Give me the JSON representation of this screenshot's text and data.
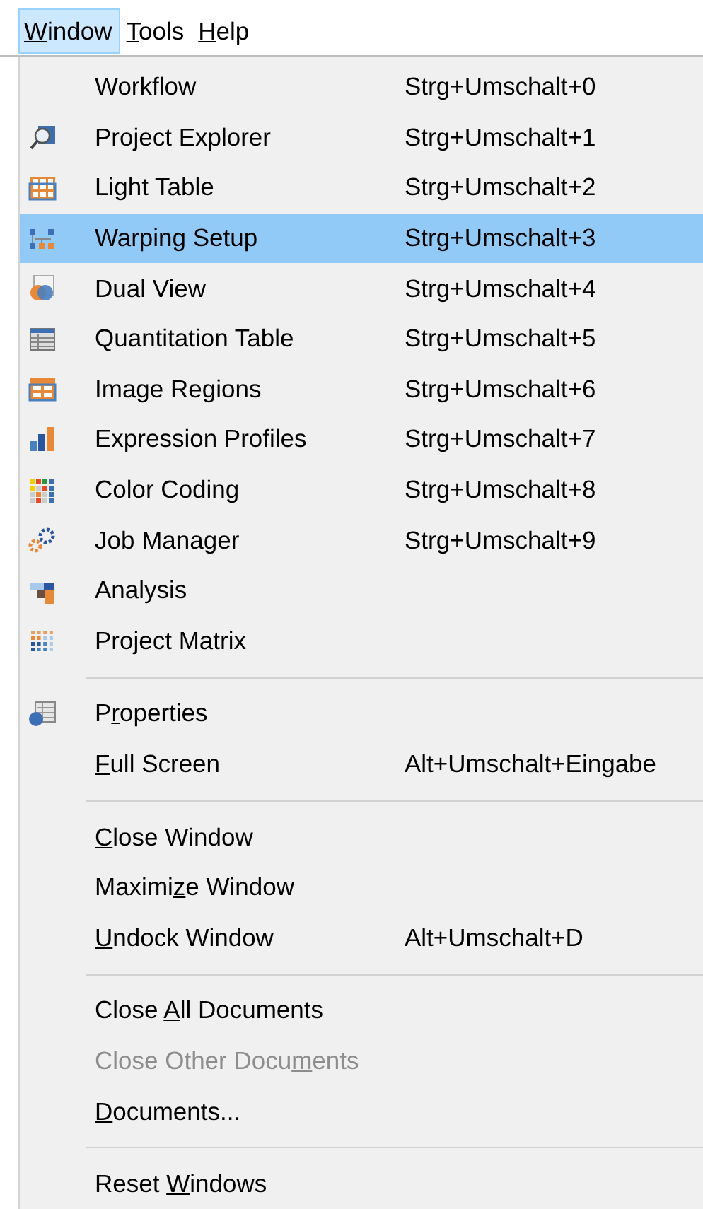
{
  "menubar": [
    {
      "access_key": "W",
      "label_post": "indow",
      "selected": true
    },
    {
      "access_key": "T",
      "label_post": "ools",
      "selected": false
    },
    {
      "access_key": "H",
      "label_post": "elp",
      "selected": false
    }
  ],
  "menu": {
    "groups": [
      [
        {
          "label": "Workflow",
          "shortcut": "Strg+Umschalt+0",
          "selected": false,
          "disabled": false
        },
        {
          "label": "Project Explorer",
          "shortcut": "Strg+Umschalt+1",
          "kind": "magnifier",
          "selected": false,
          "disabled": false
        },
        {
          "label": "Light Table",
          "shortcut": "Strg+Umschalt+2",
          "kind": "tiles",
          "selected": false,
          "disabled": false
        },
        {
          "label": "Warping Setup",
          "shortcut": "Strg+Umschalt+3",
          "kind": "network",
          "selected": true,
          "disabled": false
        },
        {
          "label": "Dual View",
          "shortcut": "Strg+Umschalt+4",
          "kind": "circles",
          "selected": false,
          "disabled": false
        },
        {
          "label": "Quantitation Table",
          "shortcut": "Strg+Umschalt+5",
          "kind": "table",
          "selected": false,
          "disabled": false
        },
        {
          "label": "Image Regions",
          "shortcut": "Strg+Umschalt+6",
          "kind": "regions",
          "selected": false,
          "disabled": false
        },
        {
          "label": "Expression Profiles",
          "shortcut": "Strg+Umschalt+7",
          "kind": "bars",
          "selected": false,
          "disabled": false
        },
        {
          "label": "Color Coding",
          "shortcut": "Strg+Umschalt+8",
          "kind": "colordots",
          "selected": false,
          "disabled": false
        },
        {
          "label": "Job Manager",
          "shortcut": "Strg+Umschalt+9",
          "kind": "gears",
          "selected": false,
          "disabled": false
        },
        {
          "label": "Analysis",
          "kind": "blocks",
          "selected": false,
          "disabled": false
        },
        {
          "label": "Project Matrix",
          "kind": "dots",
          "selected": false,
          "disabled": false
        }
      ],
      [
        {
          "label_pre": "P",
          "access_key": "r",
          "label_post": "operties",
          "kind": "sheet",
          "selected": false,
          "disabled": false
        },
        {
          "access_key": "F",
          "label_post": "ull Screen",
          "shortcut": "Alt+Umschalt+Eingabe",
          "selected": false,
          "disabled": false
        }
      ],
      [
        {
          "access_key": "C",
          "label_post": "lose Window",
          "selected": false,
          "disabled": false
        },
        {
          "label_pre": "Maximi",
          "access_key": "z",
          "label_post": "e Window",
          "selected": false,
          "disabled": false
        },
        {
          "access_key": "U",
          "label_post": "ndock Window",
          "shortcut": "Alt+Umschalt+D",
          "selected": false,
          "disabled": false
        }
      ],
      [
        {
          "label_pre": "Close ",
          "access_key": "A",
          "label_post": "ll Documents",
          "selected": false,
          "disabled": false
        },
        {
          "label_pre": "Close Other Docu",
          "access_key": "m",
          "label_post": "ents",
          "selected": false,
          "disabled": true
        },
        {
          "access_key": "D",
          "label_post": "ocuments...",
          "selected": false,
          "disabled": false
        }
      ],
      [
        {
          "label_pre": "Reset ",
          "access_key": "W",
          "label_post": "indows",
          "selected": false,
          "disabled": false
        }
      ]
    ]
  }
}
